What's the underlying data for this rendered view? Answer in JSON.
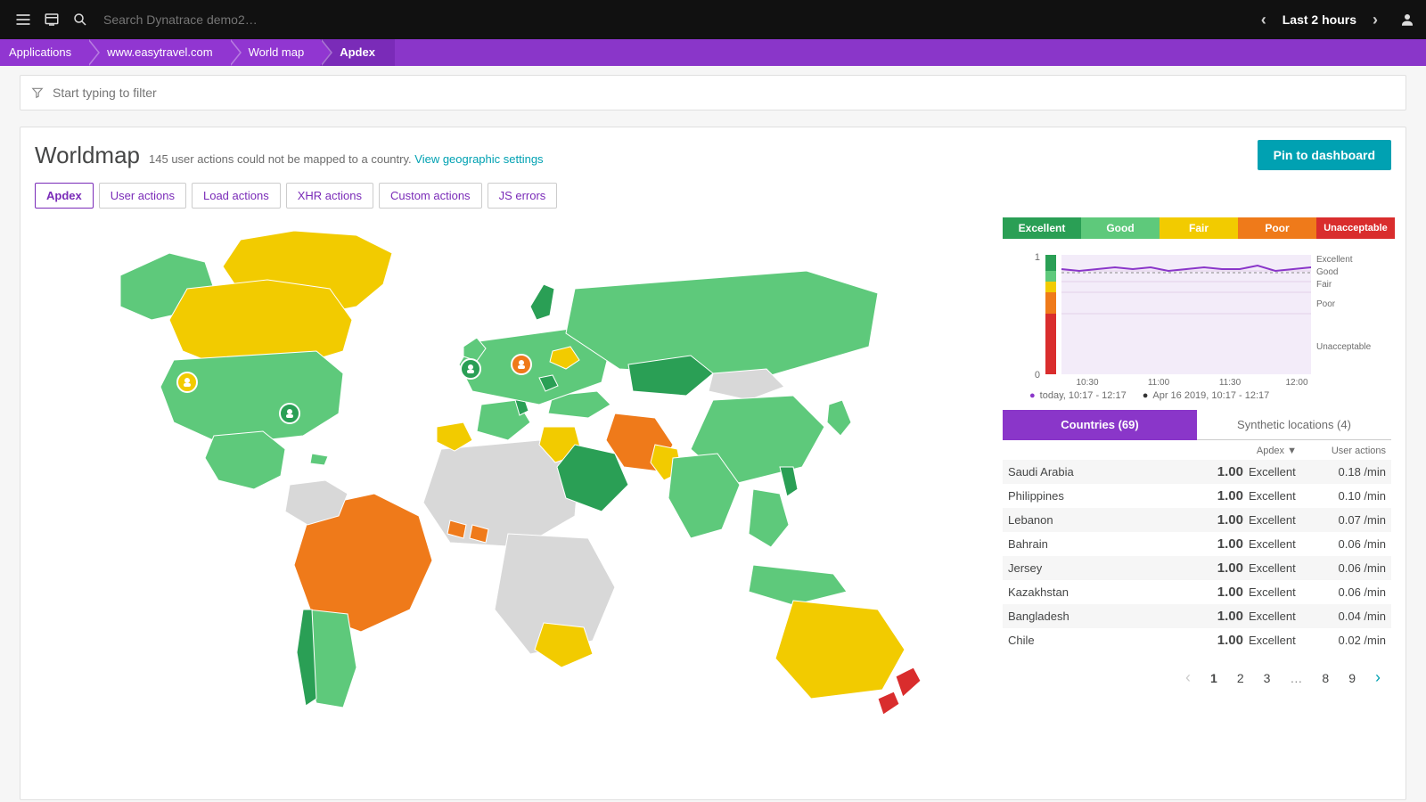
{
  "topbar": {
    "search_placeholder": "Search Dynatrace demo2…",
    "timeframe": "Last 2 hours"
  },
  "breadcrumbs": [
    "Applications",
    "www.easytravel.com",
    "World map",
    "Apdex"
  ],
  "filter": {
    "placeholder": "Start typing to filter"
  },
  "header": {
    "title": "Worldmap",
    "unmapped_text": "145 user actions could not be mapped to a country.",
    "settings_link": "View geographic settings",
    "pin_btn": "Pin to dashboard"
  },
  "tabs": [
    "Apdex",
    "User actions",
    "Load actions",
    "XHR actions",
    "Custom actions",
    "JS errors"
  ],
  "legend": {
    "ex": "Excellent",
    "gd": "Good",
    "fr": "Fair",
    "pr": "Poor",
    "un": "Unacceptable"
  },
  "chart_data": {
    "type": "line",
    "title": "",
    "ylabel": "",
    "ylim": [
      0,
      1
    ],
    "y_ticks": [
      0,
      1
    ],
    "x_ticks": [
      "10:30",
      "11:00",
      "11:30",
      "12:00"
    ],
    "band_labels": [
      "Excellent",
      "Good",
      "Fair",
      "Poor",
      "Unacceptable"
    ],
    "series": [
      {
        "name": "today, 10:17 - 12:17",
        "color": "#8a36c9",
        "values": [
          0.92,
          0.91,
          0.92,
          0.93,
          0.92,
          0.93,
          0.91,
          0.92,
          0.93,
          0.92,
          0.92,
          0.94,
          0.91,
          0.92
        ]
      },
      {
        "name": "Apr 16 2019, 10:17 - 12:17",
        "color": "#333333",
        "values": [
          0.9,
          0.9,
          0.9,
          0.9,
          0.9,
          0.9,
          0.9,
          0.9,
          0.9,
          0.9,
          0.9,
          0.9,
          0.9,
          0.9
        ]
      }
    ]
  },
  "mini_legend": {
    "today": "today, 10:17 - 12:17",
    "compare": "Apr 16 2019, 10:17 - 12:17"
  },
  "subtabs": {
    "countries": "Countries (69)",
    "synthetic": "Synthetic locations (4)"
  },
  "table": {
    "head": {
      "country": "",
      "apdex": "Apdex ▼",
      "ua": "User actions"
    },
    "rows": [
      {
        "c": "Saudi Arabia",
        "av": "1.00",
        "al": "Excellent",
        "u": "0.18 /min"
      },
      {
        "c": "Philippines",
        "av": "1.00",
        "al": "Excellent",
        "u": "0.10 /min"
      },
      {
        "c": "Lebanon",
        "av": "1.00",
        "al": "Excellent",
        "u": "0.07 /min"
      },
      {
        "c": "Bahrain",
        "av": "1.00",
        "al": "Excellent",
        "u": "0.06 /min"
      },
      {
        "c": "Jersey",
        "av": "1.00",
        "al": "Excellent",
        "u": "0.06 /min"
      },
      {
        "c": "Kazakhstan",
        "av": "1.00",
        "al": "Excellent",
        "u": "0.06 /min"
      },
      {
        "c": "Bangladesh",
        "av": "1.00",
        "al": "Excellent",
        "u": "0.04 /min"
      },
      {
        "c": "Chile",
        "av": "1.00",
        "al": "Excellent",
        "u": "0.02 /min"
      }
    ]
  },
  "pager": {
    "pages": [
      "1",
      "2",
      "3",
      "…",
      "8",
      "9"
    ],
    "current": "1"
  }
}
